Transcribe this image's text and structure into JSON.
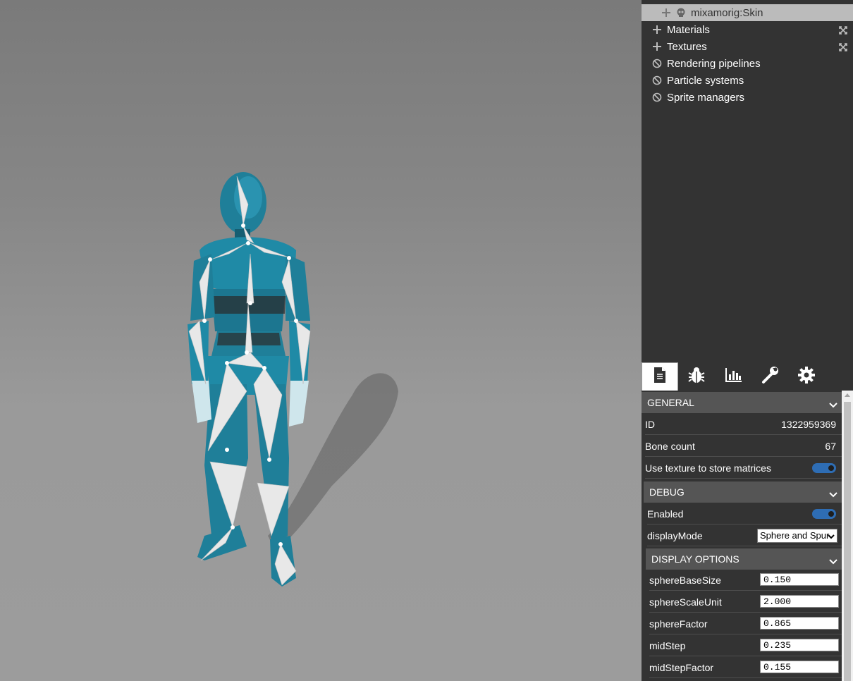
{
  "explorer": {
    "items": [
      {
        "label": "mixamorig:Skin",
        "icon": "skull-icon",
        "selected": true
      },
      {
        "label": "Materials",
        "icon": "plus-icon",
        "expand": "expand-icon"
      },
      {
        "label": "Textures",
        "icon": "plus-icon",
        "expand": "expand-icon"
      },
      {
        "label": "Rendering pipelines",
        "icon": "ban-icon"
      },
      {
        "label": "Particle systems",
        "icon": "ban-icon"
      },
      {
        "label": "Sprite managers",
        "icon": "ban-icon"
      }
    ]
  },
  "inspector": {
    "tabs": [
      {
        "icon": "document-icon",
        "active": true
      },
      {
        "icon": "bug-icon"
      },
      {
        "icon": "chart-icon"
      },
      {
        "icon": "wrench-icon"
      },
      {
        "icon": "gear-icon"
      }
    ],
    "general": {
      "title": "GENERAL",
      "id_label": "ID",
      "id_value": "1322959369",
      "bone_count_label": "Bone count",
      "bone_count_value": "67",
      "use_texture_label": "Use texture to store matrices",
      "use_texture_on": true
    },
    "debug": {
      "title": "DEBUG",
      "enabled_label": "Enabled",
      "enabled_on": true,
      "display_mode_label": "displayMode",
      "display_mode_value": "Sphere and Spur"
    },
    "display_options": {
      "title": "DISPLAY OPTIONS",
      "fields": [
        {
          "label": "sphereBaseSize",
          "value": "0.150"
        },
        {
          "label": "sphereScaleUnit",
          "value": "2.000"
        },
        {
          "label": "sphereFactor",
          "value": "0.865"
        },
        {
          "label": "midStep",
          "value": "0.235"
        },
        {
          "label": "midStepFactor",
          "value": "0.155"
        }
      ]
    }
  },
  "colors": {
    "panel_bg": "#333333",
    "section_bg": "#555555",
    "toggle_on": "#2e6db4",
    "model_teal": "#1f7f99",
    "bone_white": "#e6e6e6"
  }
}
